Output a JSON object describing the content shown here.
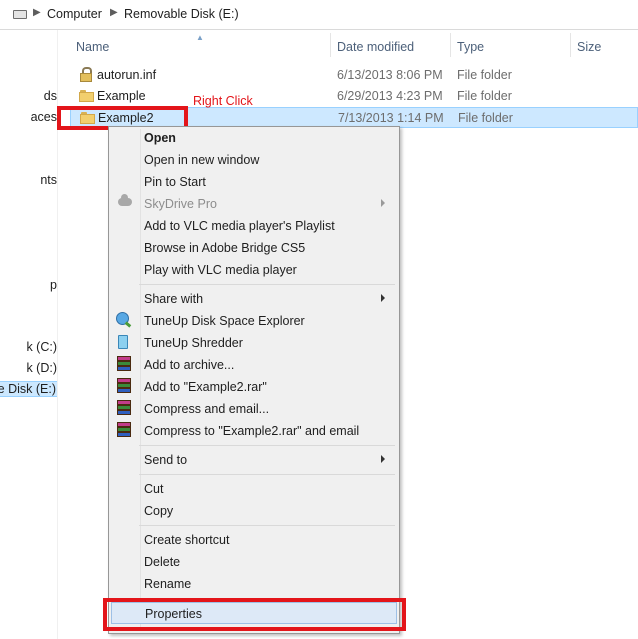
{
  "address_bar": {
    "breadcrumbs": [
      "Computer",
      "Removable Disk (E:)"
    ]
  },
  "nav_pane": {
    "items": [
      {
        "label": "ds"
      },
      {
        "label": "aces"
      },
      {
        "label": "nts"
      },
      {
        "label": "p"
      },
      {
        "label": "k (C:)"
      },
      {
        "label": "k (D:)"
      },
      {
        "label": "ble Disk (E:)",
        "selected": true
      }
    ]
  },
  "columns": {
    "name": "Name",
    "date_modified": "Date modified",
    "type": "Type",
    "size": "Size"
  },
  "files": [
    {
      "name": "autorun.inf",
      "date": "6/13/2013 8:06 PM",
      "type": "File folder",
      "icon": "locked-folder-icon"
    },
    {
      "name": "Example",
      "date": "6/29/2013 4:23 PM",
      "type": "File folder",
      "icon": "folder-icon"
    },
    {
      "name": "Example2",
      "date": "7/13/2013 1:14 PM",
      "type": "File folder",
      "icon": "folder-icon",
      "selected": true
    }
  ],
  "annotation": {
    "right_click_label": "Right Click",
    "color": "#e3151a"
  },
  "context_menu": {
    "items": [
      {
        "label": "Open",
        "bold": true
      },
      {
        "label": "Open in new window"
      },
      {
        "label": "Pin to Start"
      },
      {
        "label": "SkyDrive Pro",
        "disabled": true,
        "submenu": true,
        "icon": "cloud-icon"
      },
      {
        "label": "Add to VLC media player's Playlist"
      },
      {
        "label": "Browse in Adobe Bridge CS5"
      },
      {
        "label": "Play with VLC media player"
      },
      {
        "label": "Share with",
        "submenu": true
      },
      {
        "label": "TuneUp Disk Space Explorer",
        "icon": "disk-space-explorer-icon"
      },
      {
        "label": "TuneUp Shredder",
        "icon": "shredder-icon"
      },
      {
        "label": "Add to archive...",
        "icon": "winrar-icon"
      },
      {
        "label": "Add to \"Example2.rar\"",
        "icon": "winrar-icon"
      },
      {
        "label": "Compress and email...",
        "icon": "winrar-icon"
      },
      {
        "label": "Compress to \"Example2.rar\" and email",
        "icon": "winrar-icon"
      },
      {
        "label": "Send to",
        "submenu": true
      },
      {
        "label": "Cut"
      },
      {
        "label": "Copy"
      },
      {
        "label": "Create shortcut"
      },
      {
        "label": "Delete"
      },
      {
        "label": "Rename"
      },
      {
        "label": "Properties",
        "hover": true
      }
    ]
  }
}
